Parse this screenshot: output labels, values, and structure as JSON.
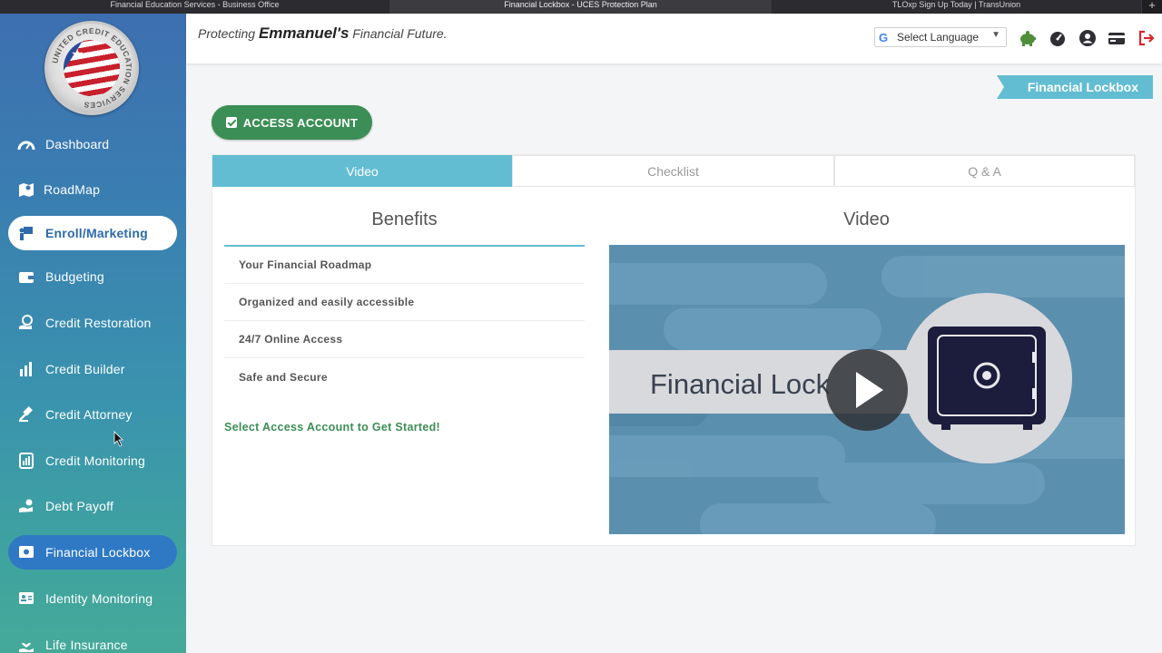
{
  "browser": {
    "tabs": [
      "Financial Education Services - Business Office",
      "Financial Lockbox - UCES Protection Plan",
      "TLOxp Sign Up Today | TransUnion"
    ],
    "new_tab": "+"
  },
  "logo": {
    "text": "UNITED CREDIT EDUCATION SERVICES"
  },
  "sidebar": {
    "items": [
      {
        "label": "Dashboard",
        "icon": "speedometer-icon"
      },
      {
        "label": "RoadMap",
        "icon": "map-icon"
      },
      {
        "label": "Enroll/Marketing",
        "icon": "presenter-icon"
      },
      {
        "label": "Budgeting",
        "icon": "wallet-icon"
      },
      {
        "label": "Credit Restoration",
        "icon": "hand-dollar-icon"
      },
      {
        "label": "Credit Builder",
        "icon": "building-chart-icon"
      },
      {
        "label": "Credit Attorney",
        "icon": "gavel-icon"
      },
      {
        "label": "Credit Monitoring",
        "icon": "bar-chart-icon"
      },
      {
        "label": "Debt Payoff",
        "icon": "hand-coin-icon"
      },
      {
        "label": "Financial Lockbox",
        "icon": "safe-icon"
      },
      {
        "label": "Identity Monitoring",
        "icon": "id-card-icon"
      },
      {
        "label": "Life Insurance",
        "icon": "heart-hand-icon"
      }
    ]
  },
  "header": {
    "tagline_prefix": "Protecting ",
    "tagline_name": "Emmanuel's",
    "tagline_suffix": " Financial Future.",
    "language": "Select Language",
    "language_arrow": "▼",
    "google_g": "G",
    "icons": [
      "piggy-bank-icon",
      "gauge-icon",
      "user-icon",
      "credit-card-icon",
      "logout-icon"
    ]
  },
  "page": {
    "badge": "Financial Lockbox",
    "access_button": "ACCESS ACCOUNT",
    "tabs": [
      "Video",
      "Checklist",
      "Q & A"
    ],
    "active_tab": "Video",
    "benefits_title": "Benefits",
    "benefits": [
      "Your Financial Roadmap",
      "Organized and easily accessible",
      "24/7 Online Access",
      "Safe and Secure"
    ],
    "cta": "Select Access Account to Get Started!",
    "video_title": "Video",
    "video_text": "Financial Lock"
  },
  "colors": {
    "accent": "#62bdd3",
    "green": "#3b8e55",
    "video_bg": "#5b8fae",
    "safe": "#1c1c3c"
  }
}
